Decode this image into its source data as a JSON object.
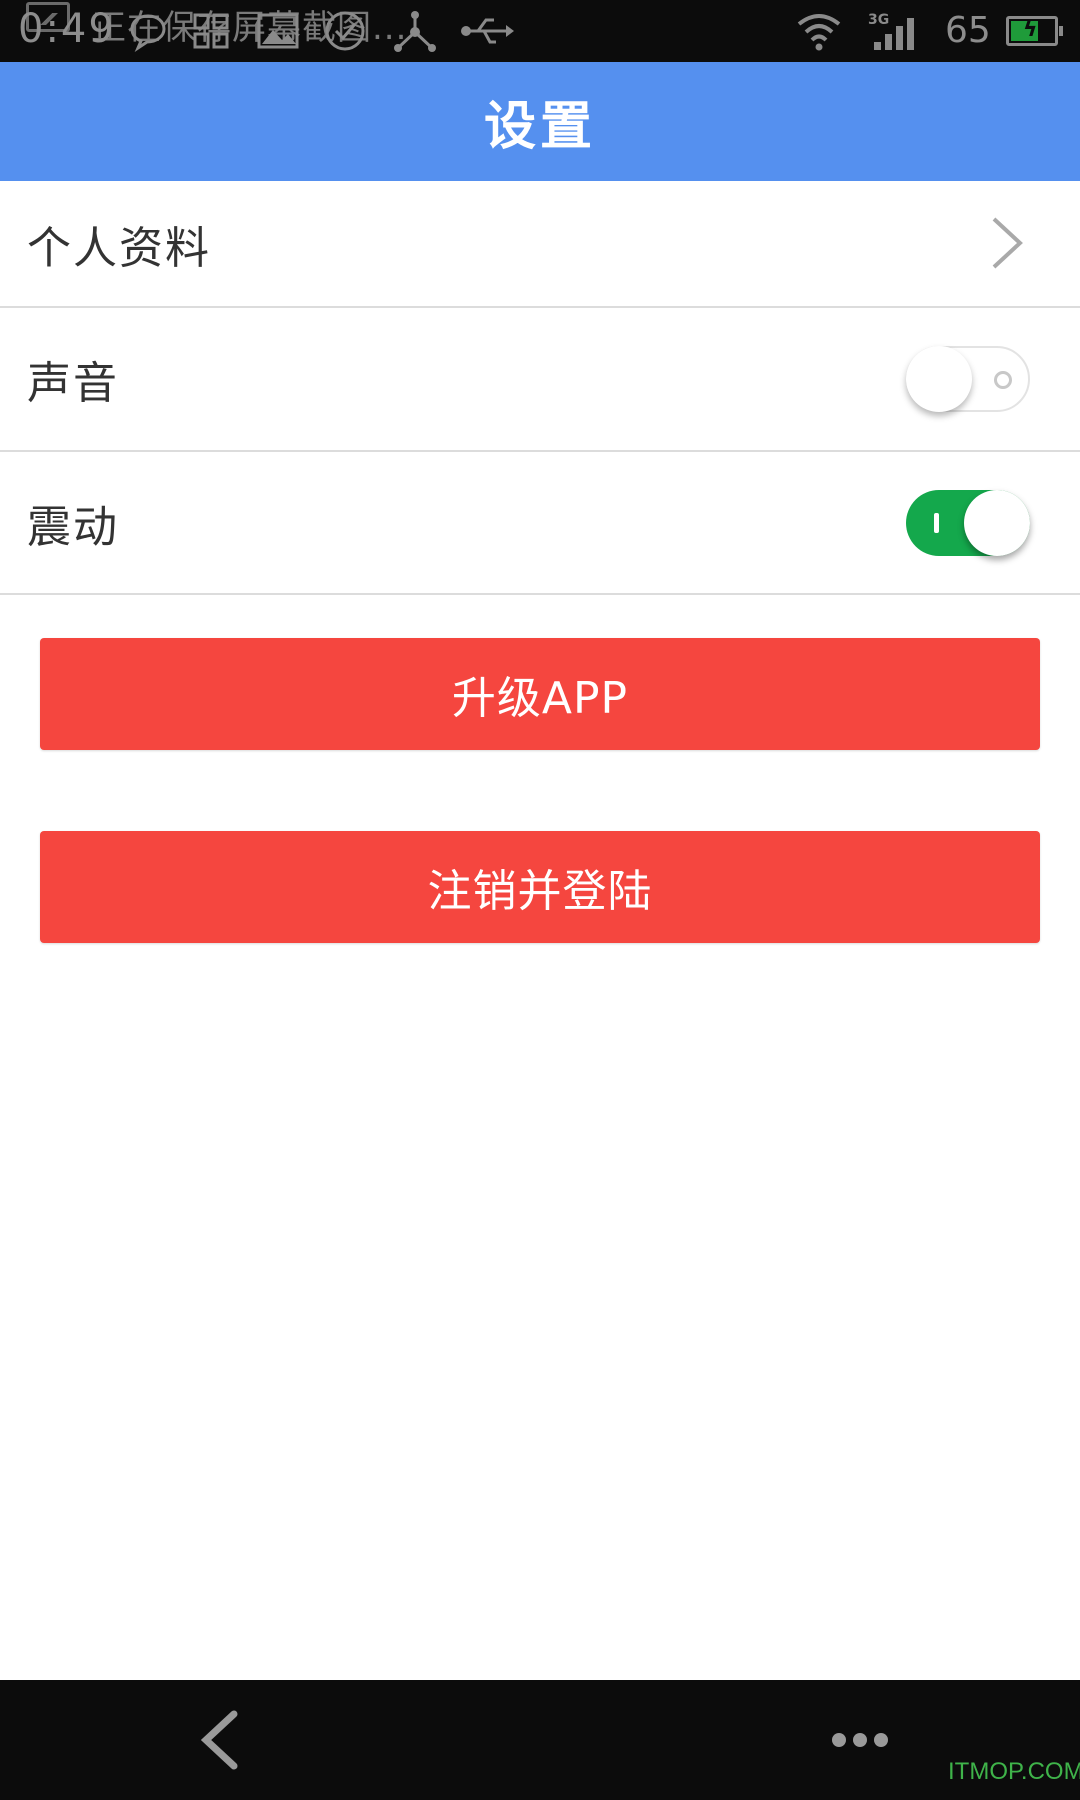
{
  "status_bar": {
    "time": "0:49",
    "ticker": "正在保存屏幕截图...",
    "network": "3G",
    "battery": "65",
    "battery_level": 0.65,
    "icons": [
      "screenshot-icon",
      "chat-bubble-icon",
      "apps-grid-icon",
      "image-icon",
      "check-circle-icon",
      "share-nodes-icon",
      "usb-icon",
      "wifi-icon",
      "signal-bars-icon",
      "battery-charging-icon"
    ]
  },
  "header": {
    "title": "设置"
  },
  "settings": {
    "profile": {
      "label": "个人资料",
      "icon": "chevron-right-icon"
    },
    "sound": {
      "label": "声音",
      "enabled": false
    },
    "vibrate": {
      "label": "震动",
      "enabled": true
    }
  },
  "buttons": {
    "upgrade": "升级APP",
    "logout": "注销并登陆"
  },
  "nav_bar": {
    "icons": [
      "back-arrow-icon",
      "more-dots-icon"
    ]
  },
  "watermark": "ITMOP.COM",
  "colors": {
    "header": "#5590ef",
    "button": "#f5463f",
    "toggle_on": "#14a84c",
    "bars": "#0c0c0c"
  }
}
